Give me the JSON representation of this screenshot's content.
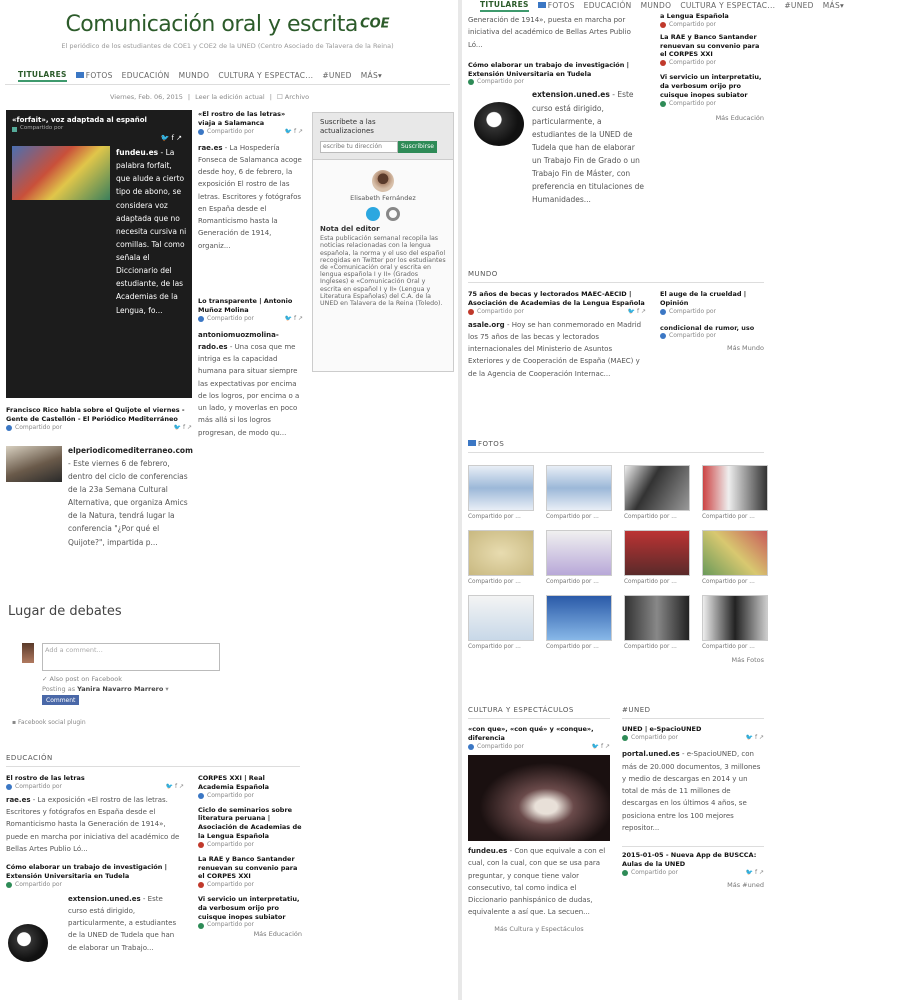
{
  "left": {
    "title": "Comunicación oral y escrita",
    "title_sup": "COE",
    "subtitle": "El periódico de los estudiantes de COE1 y COE2 de la UNED (Centro Asociado de Talavera de la Reina)",
    "nav": [
      "TITULARES",
      "FOTOS",
      "EDUCACIÓN",
      "MUNDO",
      "CULTURA Y ESPECTAC...",
      "#UNED",
      "MÁS"
    ],
    "date_line": "Viernes, Feb. 06, 2015",
    "read_current": "Leer la edición actual",
    "archive": "Archivo",
    "featured": {
      "headline": "«forfait», voz adaptada al español",
      "tag": "Compartido por",
      "source": "fundeu.es",
      "body": "- La palabra forfait, que alude a cierto tipo de abono, se considera voz adaptada que no necesita cursiva ni comillas. Tal como señala el Diccionario del estudiante, de las Academias de la Lengua, fo..."
    },
    "mid_article1": {
      "headline": "«El rostro de las letras» viaja a Salamanca",
      "shared": "Compartido por",
      "source": "rae.es",
      "body": "- La Hospedería Fonseca de Salamanca acoge desde hoy, 6 de febrero, la exposición El rostro de las letras. Escritores y fotógrafos en España desde el Romanticismo hasta la Generación de 1914, organiz..."
    },
    "mid_article2": {
      "headline": "Lo transparente | Antonio Muñoz Molina",
      "shared": "Compartido por",
      "source": "antoniomuozmolina.es",
      "source_display": "antoniomuozmolina-rado.es",
      "body": "- Una cosa que me intriga es la capacidad humana para situar siempre las expectativas por encima de los logros, por encima o a un lado, y moverlas en poco más allá si los logros progresan, de modo qu..."
    },
    "subscribe": {
      "label": "Suscríbete a las actualizaciones",
      "placeholder": "escribe tu dirección",
      "button": "Suscribirse",
      "editor_name": "Elisabeth Fernández",
      "note_title": "Nota del editor",
      "note_body": "Esta publicación semanal recopila las noticias relacionadas con la lengua española, la norma y el uso del español recogidas en Twitter por los estudiantes de «Comunicación oral y escrita en lengua española I y II» (Grados Ingleses) e «Comunicación Oral y escrita en español I y II» (Lengua y Literatura Españolas) del C.A. de la UNED en Talavera de la Reina (Toledo)."
    },
    "quixote": {
      "headline": "Francisco Rico habla sobre el Quijote el viernes - Gente de Castellón - El Periódico Mediterráneo",
      "shared": "Compartido por",
      "source": "elperiodicomediterraneo.com",
      "body": "- Este viernes 6 de febrero, dentro del ciclo de conferencias de la 23a Semana Cultural Alternativa, que organiza Amics de la Natura, tendrá lugar la conferencia \"¿Por qué el Quijote?\", impartida p..."
    },
    "debate": {
      "heading": "Lugar de debates",
      "placeholder": "Add a comment...",
      "also_post": "Also post on Facebook",
      "posting_as": "Posting as",
      "user": "Yanira Navarro Marrero",
      "comment_btn": "Comment",
      "plugin": "Facebook social plugin"
    },
    "education": {
      "heading": "EDUCACIÓN",
      "a1_headline": "El rostro de las letras",
      "a1_shared": "Compartido por",
      "a1_source": "rae.es",
      "a1_body": "- La exposición «El rostro de las letras. Escritores y fotógrafos en España desde el Romanticismo hasta la Generación de 1914», puede en marcha por iniciativa del académico de Bellas Artes Publio Ló...",
      "a2_headline": "Cómo elaborar un trabajo de investigación | Extensión Universitaria en Tudela",
      "a2_shared": "Compartido por",
      "a2_source": "extension.uned.es",
      "a2_body": "- Este curso está dirigido, particularmente, a estudiantes de la UNED de Tudela que han de elaborar un Trabajo...",
      "r1": "CORPES XXI | Real Academia Española",
      "r2": "Ciclo de seminarios sobre literatura peruana | Asociación de Academias de la Lengua Española",
      "r3": "La RAE y Banco Santander renuevan su convenio para el CORPES XXI",
      "r4": "Vi servicio un interpretatiu, da verbosum orijo pro cuisque inopes subiator",
      "more": "Más Educación"
    }
  },
  "right": {
    "nav": [
      "TITULARES",
      "FOTOS",
      "EDUCACIÓN",
      "MUNDO",
      "CULTURA Y ESPECTAC...",
      "#UNED",
      "MÁS"
    ],
    "top_body": "Generación de 1914», puesta en marcha por iniciativa del académico de Bellas Artes Publio Ló...",
    "top_a_headline": "Cómo elaborar un trabajo de investigación | Extensión Universitaria en Tudela",
    "top_a_shared": "Compartido por",
    "top_a_source": "extension.uned.es",
    "top_a_body": "- Este curso está dirigido, particularmente, a estudiantes de la UNED de Tudela que han de elaborar un Trabajo Fin de Grado o un Trabajo Fin de Máster, con preferencia en titulaciones de Humanidades...",
    "top_r0": "a Lengua Española",
    "top_r1": "La RAE y Banco Santander renuevan su convenio para el CORPES XXI",
    "top_r2": "Vi servicio un interpretatiu, da verbosum orijo pro cuisque inopes subiator",
    "top_more": "Más Educación",
    "mundo": {
      "heading": "MUNDO",
      "a_headline": "75 años de becas y lectorados MAEC-AECID | Asociación de Academias de la Lengua Española",
      "a_shared": "Compartido por",
      "a_source": "asale.org",
      "a_body": "- Hoy se han conmemorado en Madrid los 75 años de las becas y lectorados internacionales del Ministerio de Asuntos Exteriores y de Cooperación de España (MAEC) y de la Agencia de Cooperación Internac...",
      "b_headline": "El auge de la crueldad | Opinión",
      "b_shared": "Compartido por",
      "b_source": "condicional de rumor, uso",
      "more": "Más Mundo"
    },
    "fotos": {
      "heading": "FOTOS",
      "captions": [
        "Compartido por ...",
        "Compartido por ...",
        "Compartido por ...",
        "Compartido por ...",
        "Compartido por ...",
        "Compartido por ...",
        "Compartido por ...",
        "Compartido por ...",
        "Compartido por ...",
        "Compartido por ...",
        "Compartido por ...",
        "Compartido por ..."
      ],
      "more": "Más Fotos"
    },
    "cultura": {
      "heading": "CULTURA Y ESPECTÁCULOS",
      "a_headline": "«con que», «con qué» y «conque», diferencia",
      "a_shared": "Compartido por",
      "a_source": "fundeu.es",
      "a_body": "- Con que equivale a con el cual, con la cual, con que se usa para preguntar, y conque tiene valor consecutivo, tal como indica el Diccionario panhispánico de dudas, equivalente a así que. La secuen...",
      "more": "Más Cultura y Espectáculos"
    },
    "uned": {
      "heading": "#UNED",
      "a_headline": "UNED | e-SpacioUNED",
      "a_shared": "Compartido por",
      "a_source": "portal.uned.es",
      "a_body": "- e-SpacioUNED, con más de 20.000 documentos, 3 millones y medio de descargas en 2014 y un total de más de 11 millones de descargas en los últimos 4 años, se posiciona entre los 100 mejores repositor...",
      "b_headline": "2015-01-05 - Nueva App de BUSCCA: Aulas de la UNED",
      "b_shared": "Compartido por",
      "more": "Más #uned"
    }
  },
  "colors": {
    "accent": "#3e9a6d",
    "title": "#2c5b2a",
    "link": "#2a6ab0",
    "dark_card": "#1c1c1c"
  }
}
